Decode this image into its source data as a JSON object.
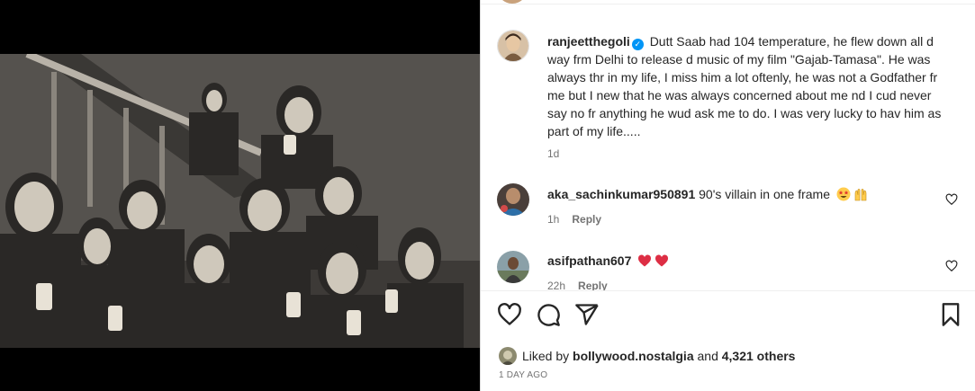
{
  "post": {
    "author": "ranjeetthegoli",
    "caption": "Dutt Saab had 104 temperature, he flew down all d way frm Delhi to release d music of my film \"Gajab-Tamasa\". He was always thr in my life, I miss him a lot oftenly, he was not a Godfather fr me but I new that he was always concerned about me nd I cud never say no fr anything he wud ask me to do. I was very lucky to hav him as part of my life.....",
    "age": "1d"
  },
  "comments": [
    {
      "username": "aka_sachinkumar950891",
      "text": "90's villain in one frame",
      "emojis": [
        "star-struck-emoji",
        "raising-hands-emoji"
      ],
      "age": "1h",
      "reply": "Reply"
    },
    {
      "username": "asifpathan607",
      "text": "",
      "emojis": [
        "red-heart-emoji",
        "red-heart-emoji"
      ],
      "age": "22h",
      "reply": "Reply"
    }
  ],
  "likes": {
    "prefix": "Liked by",
    "user": "bollywood.nostalgia",
    "and": "and",
    "count": "4,321 others"
  },
  "date": "1 DAY AGO",
  "icons": [
    "heart-icon",
    "comment-icon",
    "share-icon",
    "bookmark-icon",
    "verified-badge-icon",
    "like-comment-icon"
  ],
  "colors": {
    "verified": "#0095f6",
    "heart": "#ed4956",
    "muted": "#737373",
    "text": "#262626"
  }
}
